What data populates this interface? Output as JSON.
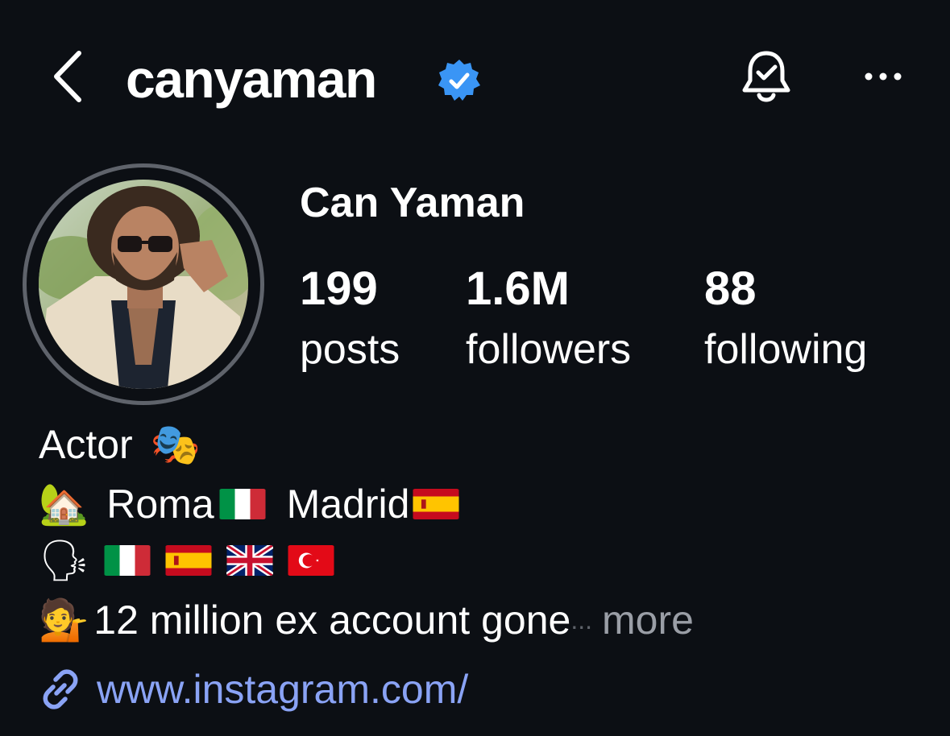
{
  "header": {
    "username": "canyaman",
    "back_icon": "chevron-left-icon",
    "verified_icon": "verified-badge-icon",
    "bell_icon": "bell-check-icon",
    "more_icon": "more-horizontal-icon"
  },
  "profile": {
    "full_name": "Can Yaman",
    "stats": [
      {
        "value": "199",
        "label": "posts"
      },
      {
        "value": "1.6M",
        "label": "followers"
      },
      {
        "value": "88",
        "label": "following"
      }
    ]
  },
  "bio": {
    "line1_text": "Actor",
    "line1_emoji": "🎭",
    "line2_emoji": "🏡",
    "line2_city1": "Roma",
    "line2_city2": "Madrid",
    "line3_emoji": "🗣",
    "line4_emoji": "💁",
    "line4_text": "12 million ex account gone",
    "line4_ellipsis": "...",
    "more_label": "more"
  },
  "link": {
    "icon": "link-icon",
    "url": "www.instagram.com/"
  },
  "colors": {
    "background": "#0c0f14",
    "verified": "#3a95f5",
    "link": "#8aa3f5",
    "muted": "#9a9ea6"
  }
}
